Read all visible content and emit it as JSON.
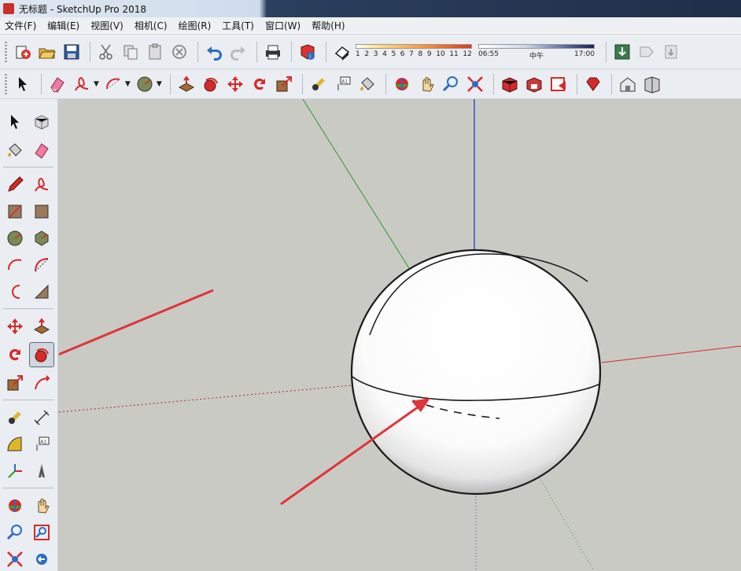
{
  "window": {
    "title": "无标题 - SketchUp Pro 2018"
  },
  "menu": {
    "items": [
      "文件(F)",
      "编辑(E)",
      "视图(V)",
      "相机(C)",
      "绘图(R)",
      "工具(T)",
      "窗口(W)",
      "帮助(H)"
    ]
  },
  "shadow": {
    "months": [
      "1",
      "2",
      "3",
      "4",
      "5",
      "6",
      "7",
      "8",
      "9",
      "10",
      "11",
      "12"
    ],
    "time_start": "06:55",
    "time_mid": "中午",
    "time_end": "17:00"
  },
  "colors": {
    "accent_red": "#e0343a",
    "axis_red": "#d42a2a",
    "axis_green": "#2e9a2e",
    "axis_blue": "#2848c8",
    "viewport_bg": "#cacac5"
  },
  "toolbar1": {
    "icons": [
      "new-file-icon",
      "open-file-icon",
      "save-icon",
      "cut-icon",
      "copy-icon",
      "paste-icon",
      "erase-icon",
      "undo-icon",
      "redo-icon",
      "print-icon",
      "model-info-icon",
      "shadow-toggle-icon"
    ],
    "right_icons": [
      "component-download-icon",
      "share-icon",
      "extension-icon"
    ]
  },
  "toolbar2": {
    "icons": [
      "select-arrow-icon",
      "eraser-icon",
      "freehand-icon",
      "arc-icon",
      "circle-icon",
      "push-pull-icon",
      "follow-me-icon",
      "move-icon",
      "rotate-icon",
      "scale-icon",
      "tape-measure-icon",
      "text-icon",
      "paint-bucket-icon",
      "orbit-icon",
      "pan-icon",
      "zoom-icon",
      "zoom-extents-icon",
      "warehouse-icon",
      "extension-warehouse-icon",
      "layout-icon",
      "ruby-icon",
      "house-icon",
      "view-icon"
    ]
  },
  "left_toolbar": {
    "rows": [
      [
        "select-arrow-icon",
        "make-component-icon"
      ],
      [
        "paint-bucket-icon",
        "eraser-icon"
      ],
      [
        "pencil-icon",
        "freehand-icon"
      ],
      [
        "rectangle-icon",
        "rotated-rectangle-icon"
      ],
      [
        "circle-icon",
        "polygon-icon"
      ],
      [
        "arc-icon",
        "pie-icon"
      ],
      [
        "three-point-arc-icon",
        "two-point-arc-icon"
      ],
      [
        "move-icon",
        "push-pull-icon"
      ],
      [
        "rotate-icon",
        "follow-me-icon"
      ],
      [
        "scale-icon",
        "offset-icon"
      ],
      [
        "tape-measure-icon",
        "dimension-icon"
      ],
      [
        "protractor-icon",
        "text-icon"
      ],
      [
        "axes-icon",
        "3d-text-icon"
      ],
      [
        "orbit-icon",
        "pan-icon"
      ],
      [
        "zoom-icon",
        "zoom-window-icon"
      ],
      [
        "zoom-extents-icon",
        "previous-view-icon"
      ]
    ],
    "selected": "follow-me-icon"
  }
}
